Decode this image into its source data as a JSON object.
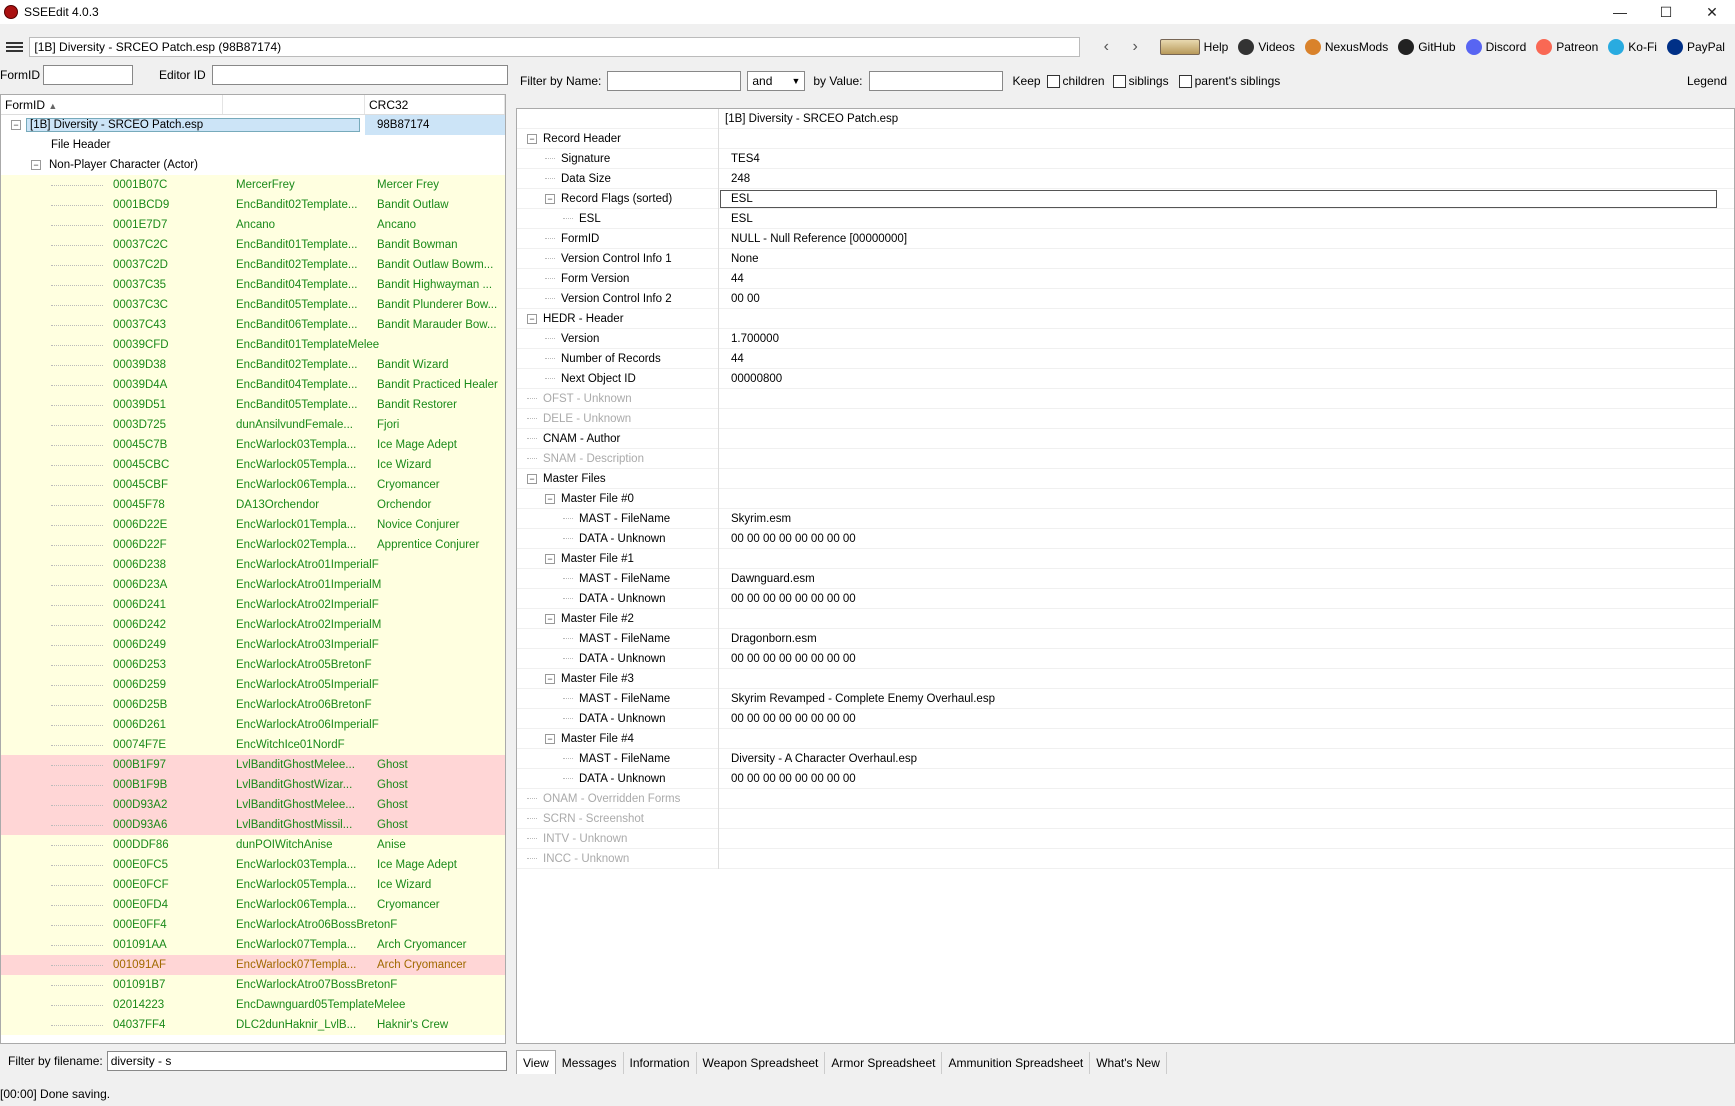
{
  "window": {
    "title": "SSEEdit 4.0.3",
    "minimize": "—",
    "maximize": "☐",
    "close": "✕"
  },
  "toolbar": {
    "path": "[1B] Diversity - SRCEO Patch.esp (98B87174)",
    "back": "‹",
    "forward": "›",
    "links": [
      {
        "label": "Help",
        "icon": "help-book-icon",
        "color": "#c8a060"
      },
      {
        "label": "Videos",
        "icon": "videos-icon",
        "color": "#333"
      },
      {
        "label": "NexusMods",
        "icon": "nexusmods-icon",
        "color": "#d9822b"
      },
      {
        "label": "GitHub",
        "icon": "github-icon",
        "color": "#222"
      },
      {
        "label": "Discord",
        "icon": "discord-icon",
        "color": "#5865f2"
      },
      {
        "label": "Patreon",
        "icon": "patreon-icon",
        "color": "#f96854"
      },
      {
        "label": "Ko-Fi",
        "icon": "kofi-icon",
        "color": "#29abe0"
      },
      {
        "label": "PayPal",
        "icon": "paypal-icon",
        "color": "#003087"
      }
    ]
  },
  "left": {
    "formid_label": "FormID",
    "editorid_label": "Editor ID",
    "formid_value": "",
    "editorid_value": "",
    "columns": [
      "FormID",
      "",
      "CRC32"
    ],
    "root": {
      "name": "[1B] Diversity - SRCEO Patch.esp",
      "crc": "98B87174"
    },
    "file_header": "File Header",
    "group": "Non-Player Character (Actor)",
    "records": [
      {
        "id": "0001B07C",
        "edid": "MercerFrey",
        "name": "Mercer Frey",
        "c": "yel"
      },
      {
        "id": "0001BCD9",
        "edid": "EncBandit02Template...",
        "name": "Bandit Outlaw",
        "c": "yel"
      },
      {
        "id": "0001E7D7",
        "edid": "Ancano",
        "name": "Ancano",
        "c": "yel"
      },
      {
        "id": "00037C2C",
        "edid": "EncBandit01Template...",
        "name": "Bandit Bowman",
        "c": "yel"
      },
      {
        "id": "00037C2D",
        "edid": "EncBandit02Template...",
        "name": "Bandit Outlaw Bowm...",
        "c": "yel"
      },
      {
        "id": "00037C35",
        "edid": "EncBandit04Template...",
        "name": "Bandit Highwayman ...",
        "c": "yel"
      },
      {
        "id": "00037C3C",
        "edid": "EncBandit05Template...",
        "name": "Bandit Plunderer Bow...",
        "c": "yel"
      },
      {
        "id": "00037C43",
        "edid": "EncBandit06Template...",
        "name": "Bandit Marauder Bow...",
        "c": "yel"
      },
      {
        "id": "00039CFD",
        "edid": "EncBandit01TemplateMelee",
        "name": "",
        "c": "yel"
      },
      {
        "id": "00039D38",
        "edid": "EncBandit02Template...",
        "name": "Bandit Wizard",
        "c": "yel"
      },
      {
        "id": "00039D4A",
        "edid": "EncBandit04Template...",
        "name": "Bandit Practiced Healer",
        "c": "yel"
      },
      {
        "id": "00039D51",
        "edid": "EncBandit05Template...",
        "name": "Bandit Restorer",
        "c": "yel"
      },
      {
        "id": "0003D725",
        "edid": "dunAnsilvundFemale...",
        "name": "Fjori",
        "c": "yel"
      },
      {
        "id": "00045C7B",
        "edid": "EncWarlock03Templa...",
        "name": "Ice Mage Adept",
        "c": "yel"
      },
      {
        "id": "00045CBC",
        "edid": "EncWarlock05Templa...",
        "name": "Ice Wizard",
        "c": "yel"
      },
      {
        "id": "00045CBF",
        "edid": "EncWarlock06Templa...",
        "name": "Cryomancer",
        "c": "yel"
      },
      {
        "id": "00045F78",
        "edid": "DA13Orchendor",
        "name": "Orchendor",
        "c": "yel"
      },
      {
        "id": "0006D22E",
        "edid": "EncWarlock01Templa...",
        "name": "Novice Conjurer",
        "c": "yel"
      },
      {
        "id": "0006D22F",
        "edid": "EncWarlock02Templa...",
        "name": "Apprentice Conjurer",
        "c": "yel"
      },
      {
        "id": "0006D238",
        "edid": "EncWarlockAtro01ImperialF",
        "name": "",
        "c": "yel"
      },
      {
        "id": "0006D23A",
        "edid": "EncWarlockAtro01ImperialM",
        "name": "",
        "c": "yel"
      },
      {
        "id": "0006D241",
        "edid": "EncWarlockAtro02ImperialF",
        "name": "",
        "c": "yel"
      },
      {
        "id": "0006D242",
        "edid": "EncWarlockAtro02ImperialM",
        "name": "",
        "c": "yel"
      },
      {
        "id": "0006D249",
        "edid": "EncWarlockAtro03ImperialF",
        "name": "",
        "c": "yel"
      },
      {
        "id": "0006D253",
        "edid": "EncWarlockAtro05BretonF",
        "name": "",
        "c": "yel"
      },
      {
        "id": "0006D259",
        "edid": "EncWarlockAtro05ImperialF",
        "name": "",
        "c": "yel"
      },
      {
        "id": "0006D25B",
        "edid": "EncWarlockAtro06BretonF",
        "name": "",
        "c": "yel"
      },
      {
        "id": "0006D261",
        "edid": "EncWarlockAtro06ImperialF",
        "name": "",
        "c": "yel"
      },
      {
        "id": "00074F7E",
        "edid": "EncWitchIce01NordF",
        "name": "",
        "c": "yel"
      },
      {
        "id": "000B1F97",
        "edid": "LvlBanditGhostMelee...",
        "name": "Ghost",
        "c": "pink"
      },
      {
        "id": "000B1F9B",
        "edid": "LvlBanditGhostWizar...",
        "name": "Ghost",
        "c": "pink"
      },
      {
        "id": "000D93A2",
        "edid": "LvlBanditGhostMelee...",
        "name": "Ghost",
        "c": "pink"
      },
      {
        "id": "000D93A6",
        "edid": "LvlBanditGhostMissil...",
        "name": "Ghost",
        "c": "pink"
      },
      {
        "id": "000DDF86",
        "edid": "dunPOIWitchAnise",
        "name": "Anise",
        "c": "yel"
      },
      {
        "id": "000E0FC5",
        "edid": "EncWarlock03Templa...",
        "name": "Ice Mage Adept",
        "c": "yel"
      },
      {
        "id": "000E0FCF",
        "edid": "EncWarlock05Templa...",
        "name": "Ice Wizard",
        "c": "yel"
      },
      {
        "id": "000E0FD4",
        "edid": "EncWarlock06Templa...",
        "name": "Cryomancer",
        "c": "yel"
      },
      {
        "id": "000E0FF4",
        "edid": "EncWarlockAtro06BossBretonF",
        "name": "",
        "c": "yel"
      },
      {
        "id": "001091AA",
        "edid": "EncWarlock07Templa...",
        "name": "Arch Cryomancer",
        "c": "yel"
      },
      {
        "id": "001091AF",
        "edid": "EncWarlock07Templa...",
        "name": "Arch Cryomancer",
        "c": "pink-orange"
      },
      {
        "id": "001091B7",
        "edid": "EncWarlockAtro07BossBretonF",
        "name": "",
        "c": "yel"
      },
      {
        "id": "02014223",
        "edid": "EncDawnguard05TemplateMelee",
        "name": "",
        "c": "yel"
      },
      {
        "id": "04037FF4",
        "edid": "DLC2dunHaknir_LvlB...",
        "name": "Haknir's Crew",
        "c": "yel"
      }
    ],
    "filename_label": "Filter by filename:",
    "filename_value": "diversity - s"
  },
  "right": {
    "filter_name_label": "Filter by Name:",
    "filter_name_value": "",
    "op": "and",
    "filter_value_label": "by Value:",
    "filter_value_value": "",
    "keep_label": "Keep",
    "children_label": "children",
    "siblings_label": "siblings",
    "parents_siblings_label": "parent's siblings",
    "legend_label": "Legend",
    "header_value": "[1B] Diversity - SRCEO Patch.esp",
    "rows": [
      {
        "k": "Record Header",
        "v": "",
        "lvl": 0,
        "exp": "⊟"
      },
      {
        "k": "Signature",
        "v": "TES4",
        "lvl": 1
      },
      {
        "k": "Data Size",
        "v": "248",
        "lvl": 1
      },
      {
        "k": "Record Flags (sorted)",
        "v": "ESL",
        "lvl": 1,
        "exp": "⊟",
        "hl": true
      },
      {
        "k": "ESL",
        "v": "ESL",
        "lvl": 2
      },
      {
        "k": "FormID",
        "v": "NULL - Null Reference [00000000]",
        "lvl": 1
      },
      {
        "k": "Version Control Info 1",
        "v": "None",
        "lvl": 1
      },
      {
        "k": "Form Version",
        "v": "44",
        "lvl": 1
      },
      {
        "k": "Version Control Info 2",
        "v": "00 00",
        "lvl": 1
      },
      {
        "k": "HEDR - Header",
        "v": "",
        "lvl": 0,
        "exp": "⊟"
      },
      {
        "k": "Version",
        "v": "1.700000",
        "lvl": 1
      },
      {
        "k": "Number of Records",
        "v": "44",
        "lvl": 1
      },
      {
        "k": "Next Object ID",
        "v": "00000800",
        "lvl": 1
      },
      {
        "k": "OFST - Unknown",
        "v": "",
        "lvl": 0,
        "gray": true
      },
      {
        "k": "DELE - Unknown",
        "v": "",
        "lvl": 0,
        "gray": true
      },
      {
        "k": "CNAM - Author",
        "v": "",
        "lvl": 0
      },
      {
        "k": "SNAM - Description",
        "v": "",
        "lvl": 0,
        "gray": true
      },
      {
        "k": "Master Files",
        "v": "",
        "lvl": 0,
        "exp": "⊟"
      },
      {
        "k": "Master File #0",
        "v": "",
        "lvl": 1,
        "exp": "⊟"
      },
      {
        "k": "MAST - FileName",
        "v": "Skyrim.esm",
        "lvl": 2
      },
      {
        "k": "DATA - Unknown",
        "v": "00 00 00 00 00 00 00 00",
        "lvl": 2
      },
      {
        "k": "Master File #1",
        "v": "",
        "lvl": 1,
        "exp": "⊟"
      },
      {
        "k": "MAST - FileName",
        "v": "Dawnguard.esm",
        "lvl": 2
      },
      {
        "k": "DATA - Unknown",
        "v": "00 00 00 00 00 00 00 00",
        "lvl": 2
      },
      {
        "k": "Master File #2",
        "v": "",
        "lvl": 1,
        "exp": "⊟"
      },
      {
        "k": "MAST - FileName",
        "v": "Dragonborn.esm",
        "lvl": 2
      },
      {
        "k": "DATA - Unknown",
        "v": "00 00 00 00 00 00 00 00",
        "lvl": 2
      },
      {
        "k": "Master File #3",
        "v": "",
        "lvl": 1,
        "exp": "⊟"
      },
      {
        "k": "MAST - FileName",
        "v": "Skyrim Revamped - Complete Enemy Overhaul.esp",
        "lvl": 2
      },
      {
        "k": "DATA - Unknown",
        "v": "00 00 00 00 00 00 00 00",
        "lvl": 2
      },
      {
        "k": "Master File #4",
        "v": "",
        "lvl": 1,
        "exp": "⊟"
      },
      {
        "k": "MAST - FileName",
        "v": "Diversity - A Character Overhaul.esp",
        "lvl": 2
      },
      {
        "k": "DATA - Unknown",
        "v": "00 00 00 00 00 00 00 00",
        "lvl": 2
      },
      {
        "k": "ONAM - Overridden Forms",
        "v": "",
        "lvl": 0,
        "gray": true
      },
      {
        "k": "SCRN - Screenshot",
        "v": "",
        "lvl": 0,
        "gray": true
      },
      {
        "k": "INTV - Unknown",
        "v": "",
        "lvl": 0,
        "gray": true
      },
      {
        "k": "INCC - Unknown",
        "v": "",
        "lvl": 0,
        "gray": true
      }
    ]
  },
  "tabs": [
    "View",
    "Messages",
    "Information",
    "Weapon Spreadsheet",
    "Armor Spreadsheet",
    "Ammunition Spreadsheet",
    "What's New"
  ],
  "status": "[00:00] Done saving."
}
